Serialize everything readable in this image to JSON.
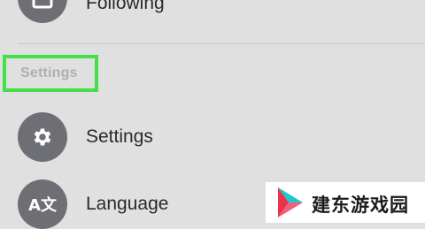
{
  "menu": {
    "following_label": "Following",
    "settings_header": "Settings",
    "settings_label": "Settings",
    "language_label": "Language",
    "language_icon_text": "A文"
  },
  "watermark": {
    "text": "建东游戏园"
  },
  "colors": {
    "background": "#e0e0e0",
    "icon_circle": "#6e6e75",
    "highlight_box": "#43e04a",
    "header_text": "#b0b0b0"
  },
  "icons": {
    "following": "following-icon",
    "settings": "gear-icon",
    "language": "translate-icon",
    "watermark_logo": "play-logo-icon"
  }
}
